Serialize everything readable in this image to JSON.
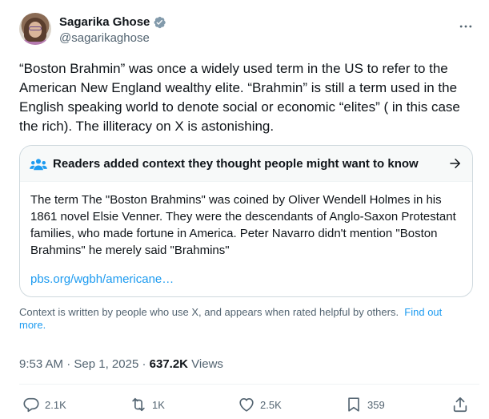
{
  "author": {
    "display_name": "Sagarika Ghose",
    "handle": "@sagarikaghose",
    "verified": true
  },
  "tweet": {
    "text": "“Boston Brahmin” was once a widely used term in the US to refer to the American New England wealthy elite. “Brahmin” is still a term used in the English speaking world to denote social or economic  “elites” ( in this case the rich). The illiteracy on X is astonishing."
  },
  "community_note": {
    "title": "Readers added context they thought people might want to know",
    "body": "The term The \"Boston Brahmins\" was coined by Oliver Wendell Holmes in his 1861 novel Elsie Venner. They were the descendants of Anglo-Saxon Protestant families, who made fortune in America. Peter Navarro didn't mention \"Boston Brahmins\" he merely said \"Brahmins\"",
    "link": "pbs.org/wgbh/americane…"
  },
  "context_note": {
    "text": "Context is written by people who use X, and appears when rated helpful by others.",
    "link": "Find out more."
  },
  "meta": {
    "time": "9:53 AM",
    "separator": " · ",
    "date": "Sep 1, 2025",
    "views_count": "637.2K",
    "views_label": " Views"
  },
  "actions": {
    "replies": "2.1K",
    "reposts": "1K",
    "likes": "2.5K",
    "bookmarks": "359"
  },
  "colors": {
    "accent": "#1d9bf0",
    "secondary_text": "#536471",
    "border": "#cfd9de"
  },
  "icons": [
    "verified-badge-icon",
    "more-icon",
    "people-icon",
    "arrow-right-icon",
    "reply-icon",
    "repost-icon",
    "like-icon",
    "bookmark-icon",
    "share-icon"
  ]
}
